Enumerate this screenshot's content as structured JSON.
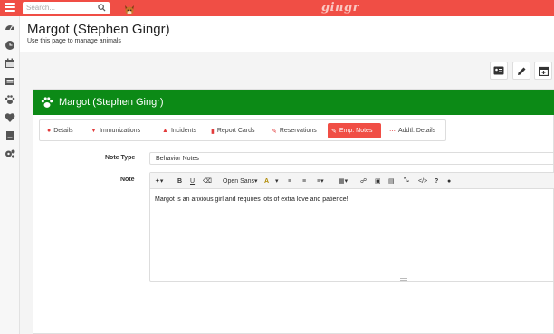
{
  "topbar": {
    "search_placeholder": "Search...",
    "brand": "gingr"
  },
  "header": {
    "title": "Margot (Stephen Gingr)",
    "subtitle": "Use this page to manage animals"
  },
  "panel": {
    "title": "Margot (Stephen Gingr)",
    "tabs": [
      {
        "label": "Details",
        "icon": "user-icon"
      },
      {
        "label": "Immunizations",
        "icon": "shield-icon"
      },
      {
        "label": "Incidents",
        "icon": "warning-icon"
      },
      {
        "label": "Report Cards",
        "icon": "file-icon"
      },
      {
        "label": "Reservations",
        "icon": "edit-icon"
      },
      {
        "label": "Emp. Notes",
        "icon": "pencil-icon",
        "active": true
      },
      {
        "label": "Addtl. Details",
        "icon": "ellipsis-icon"
      }
    ]
  },
  "form": {
    "note_type_label": "Note Type",
    "note_type_value": "Behavior Notes",
    "note_label": "Note",
    "font_name": "Open Sans",
    "note_text": "Margot is an anxious girl and requires lots of extra love and patience!"
  },
  "colors": {
    "topbar": "#f04e45",
    "panel_header": "#0c8a16",
    "active_tab": "#f04e45"
  }
}
